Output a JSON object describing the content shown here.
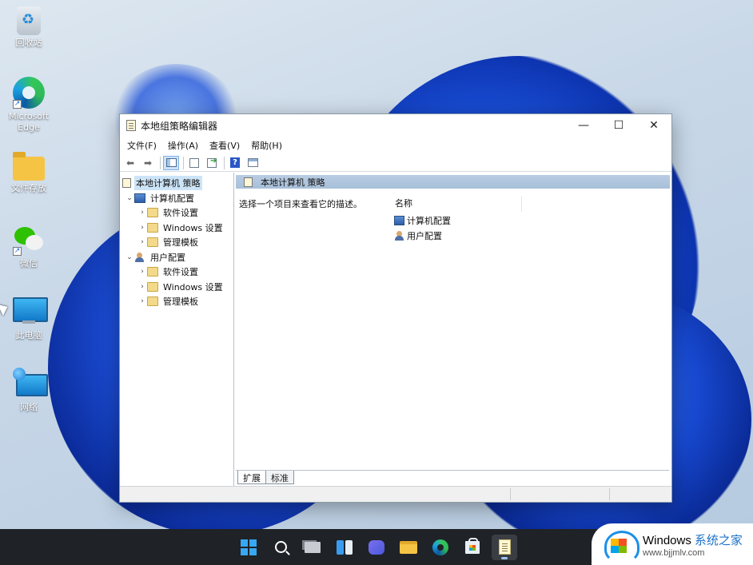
{
  "desktop": {
    "icons": [
      {
        "label": "回收站",
        "icon": "recycle-bin-icon"
      },
      {
        "label": "Microsoft Edge",
        "icon": "edge-icon"
      },
      {
        "label": "文件存放",
        "icon": "folder-icon"
      },
      {
        "label": "微信",
        "icon": "wechat-icon"
      },
      {
        "label": "此电脑",
        "icon": "computer-icon"
      },
      {
        "label": "网络",
        "icon": "network-icon"
      }
    ]
  },
  "window": {
    "title": "本地组策略编辑器",
    "controls": {
      "minimize": "—",
      "maximize": "☐",
      "close": "✕"
    },
    "menu": [
      "文件(F)",
      "操作(A)",
      "查看(V)",
      "帮助(H)"
    ],
    "tree": {
      "root": "本地计算机 策略",
      "computer": {
        "label": "计算机配置",
        "children": [
          "软件设置",
          "Windows 设置",
          "管理模板"
        ]
      },
      "user": {
        "label": "用户配置",
        "children": [
          "软件设置",
          "Windows 设置",
          "管理模板"
        ]
      }
    },
    "details": {
      "header": "本地计算机 策略",
      "description": "选择一个项目来查看它的描述。",
      "column_name": "名称",
      "items": [
        "计算机配置",
        "用户配置"
      ]
    },
    "tabs": [
      "扩展",
      "标准"
    ]
  },
  "taskbar": {
    "apps": [
      "start-icon",
      "search-icon",
      "task-view-icon",
      "widgets-icon",
      "chat-icon",
      "file-explorer-icon",
      "edge-icon",
      "store-icon",
      "group-policy-editor-icon"
    ]
  },
  "watermark": {
    "brand": "Windows",
    "brand_cn": "系统之家",
    "url": "www.bjjmlv.com"
  }
}
